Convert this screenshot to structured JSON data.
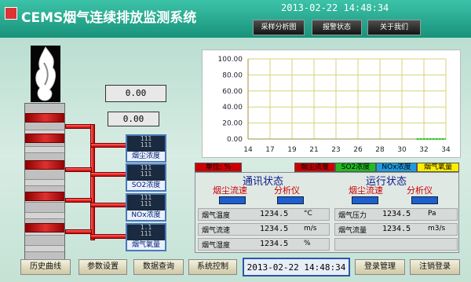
{
  "header": {
    "title": "CEMS烟气连续排放监测系统",
    "datetime": "2013-02-22 14:48:34",
    "buttons": [
      "采样分析图",
      "报警状态",
      "关于我们"
    ]
  },
  "left": {
    "display_top": "0.00",
    "display_second": "0.00",
    "sensors": [
      {
        "lines": [
          "111",
          "111"
        ],
        "label": "烟尘浓度"
      },
      {
        "lines": [
          "111",
          "111"
        ],
        "label": "SO2浓度"
      },
      {
        "lines": [
          "111",
          "111"
        ],
        "label": "NOx浓度"
      },
      {
        "lines": [
          "1.1",
          "111"
        ],
        "label": "烟气氧量"
      }
    ]
  },
  "chart_data": {
    "type": "line",
    "title": "",
    "xlabel": "",
    "ylabel": "",
    "x_ticks": [
      14,
      17,
      20,
      23,
      26,
      29,
      32,
      35,
      38,
      41
    ],
    "x_tick_labels": [
      "14",
      "17",
      "19",
      "21",
      "23",
      "26",
      "28",
      "30",
      "32",
      "34"
    ],
    "y_ticks": [
      0,
      20,
      40,
      60,
      80,
      100
    ],
    "y_tick_labels": [
      "0.00",
      "20.00",
      "40.00",
      "60.00",
      "80.00",
      "100.00"
    ],
    "ylim": [
      0,
      100
    ],
    "grid": true,
    "series": [
      {
        "color": "#22cc22",
        "values": [
          [
            37,
            0
          ],
          [
            41,
            0
          ]
        ]
      }
    ]
  },
  "legend": {
    "items": [
      {
        "label": "单位: %",
        "bg": "#cc0000",
        "fg": "#000000"
      },
      {
        "label": "烟尘浓度",
        "bg": "#cc0000",
        "fg": "#000000"
      },
      {
        "label": "SO2浓度",
        "bg": "#22bb22",
        "fg": "#000000"
      },
      {
        "label": "NOx浓度",
        "bg": "#1e9be0",
        "fg": "#000000"
      },
      {
        "label": "烟气氧量",
        "bg": "#ffee00",
        "fg": "#000000"
      }
    ]
  },
  "status": {
    "comm_title": "通讯状态",
    "run_title": "运行状态",
    "labels": [
      "烟尘流速",
      "分析仪",
      "烟尘流速",
      "分析仪"
    ]
  },
  "readings": {
    "left": [
      {
        "name": "烟气温度",
        "value": "1234.5",
        "unit": "°C"
      },
      {
        "name": "烟气流速",
        "value": "1234.5",
        "unit": "m/s"
      },
      {
        "name": "烟气湿度",
        "value": "1234.5",
        "unit": "%"
      }
    ],
    "right": [
      {
        "name": "烟气压力",
        "value": "1234.5",
        "unit": "Pa"
      },
      {
        "name": "烟气流量",
        "value": "1234.5",
        "unit": "m3/s"
      }
    ]
  },
  "footer": {
    "buttons": [
      "历史曲线",
      "参数设置",
      "数据查询",
      "系统控制",
      "登录管理",
      "注销登录"
    ],
    "datetime": "2013-02-22 14:48:34"
  },
  "colors": {
    "accent": "#18937a",
    "pipe": "#cc0000",
    "indicator": "#1d5fd1"
  }
}
